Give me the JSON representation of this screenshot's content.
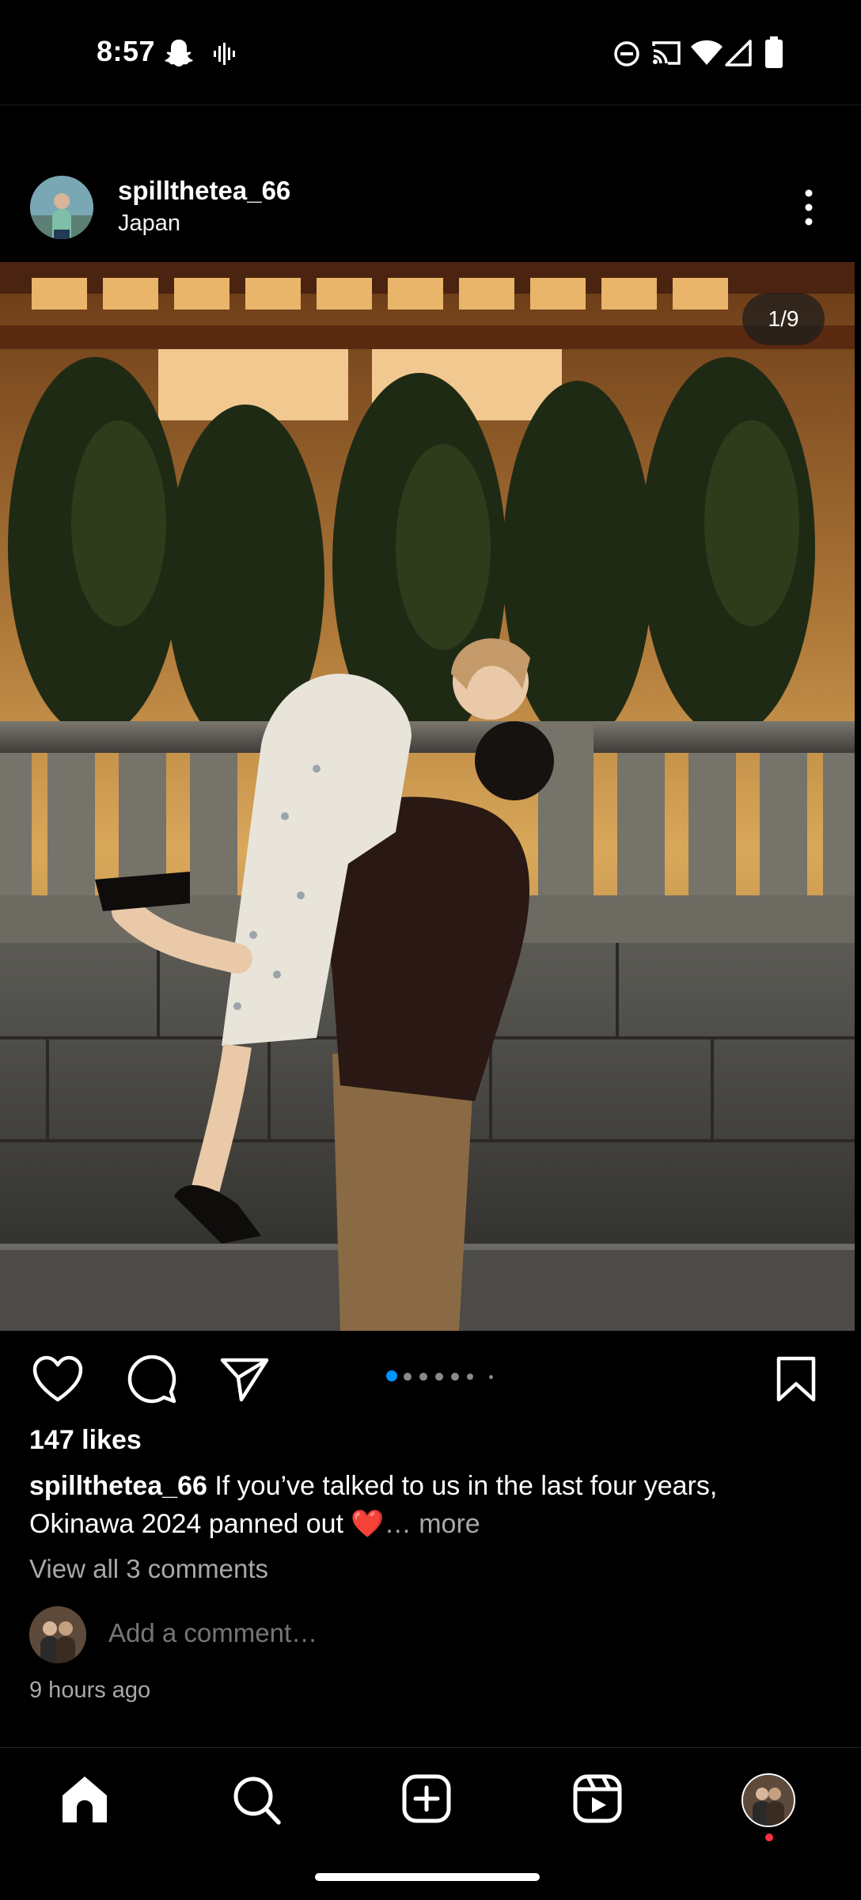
{
  "status_bar": {
    "time": "8:57",
    "icons": [
      "snapchat-icon",
      "voice-icon",
      "do-not-disturb-icon",
      "cast-icon",
      "wifi-icon",
      "signal-icon",
      "battery-icon"
    ]
  },
  "post": {
    "username": "spillthetea_66",
    "location": "Japan",
    "image_counter": "1/9",
    "carousel": {
      "count": 7,
      "active": 0
    },
    "likes": "147 likes",
    "caption_user": "spillthetea_66",
    "caption_text": " If you’ve talked to us in the last four years, Okinawa 2024 panned out ❤️",
    "caption_more": "… more",
    "view_comments": "View all 3 comments",
    "comment_placeholder": "Add a comment…",
    "timestamp": "9 hours ago"
  },
  "bottom_nav": [
    "home-icon",
    "search-icon",
    "create-icon",
    "reels-icon",
    "profile-avatar"
  ],
  "colors": {
    "background": "#000000",
    "text": "#ffffff",
    "secondary": "#a8a8a8",
    "active_dot": "#0095f6",
    "notification": "#ff3040"
  }
}
